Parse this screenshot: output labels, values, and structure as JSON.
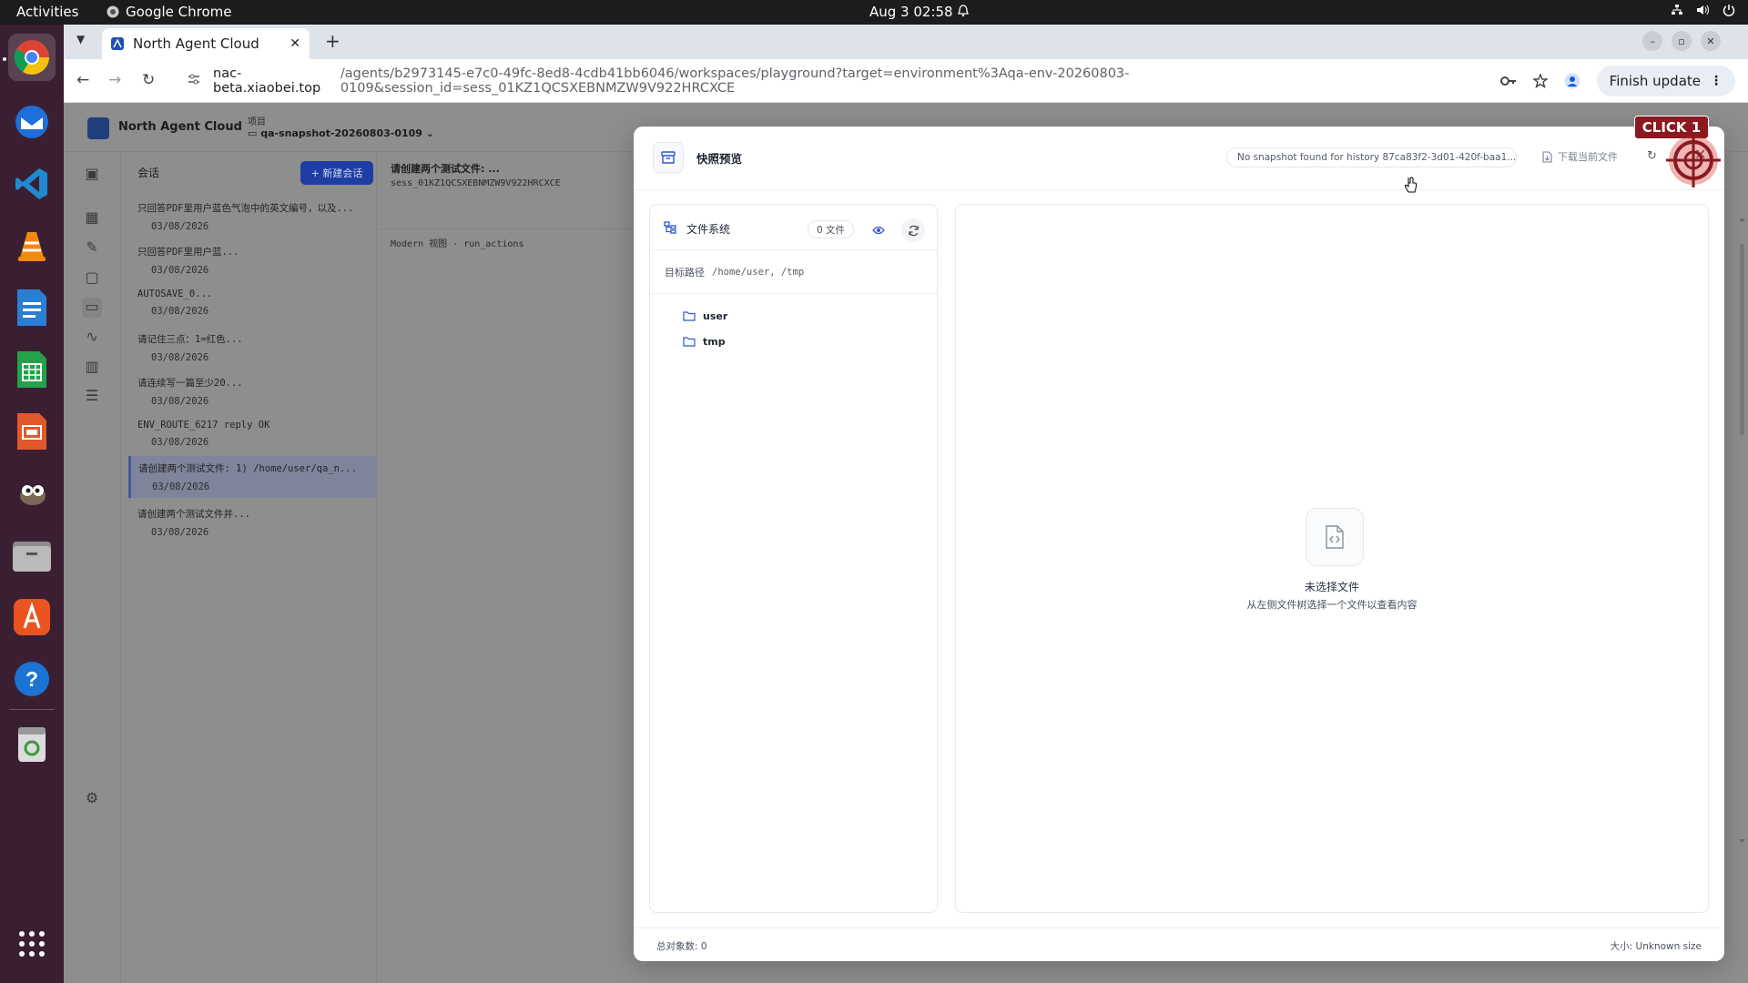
{
  "topbar": {
    "activities": "Activities",
    "app_name": "Google Chrome",
    "clock": "Aug 3  02:58"
  },
  "dock": {
    "apps": [
      "chrome-icon",
      "thunderbird-icon",
      "vscode-icon",
      "vlc-icon",
      "writer-icon",
      "calc-icon",
      "impress-icon",
      "gimp-icon",
      "files-icon",
      "appstore-icon",
      "help-icon",
      "trash-icon",
      "app-grid-icon"
    ]
  },
  "browser": {
    "tab_title": "North Agent Cloud",
    "url_host": "nac-beta.xiaobei.top",
    "url_path": "/agents/b2973145-e7c0-49fc-8ed8-4cdb41bb6046/workspaces/playground?target=environment%3Aqa-env-20260803-0109&session_id=sess_01KZ1QCSXEBNMZW9V922HRCXCE",
    "finish_update": "Finish update"
  },
  "app": {
    "brand": "North Agent Cloud",
    "project_label": "项目",
    "project_value": "qa-snapshot-20260803-0109",
    "sessions_title": "会话",
    "new_session": "+ 新建会话",
    "sessions": [
      {
        "title": "只回答PDF里用户蓝色气泡中的英文编号，以及...",
        "date": "03/08/2026"
      },
      {
        "title": "只回答PDF里用户蓝...",
        "date": "03/08/2026"
      },
      {
        "title": "AUTOSAVE_0...",
        "date": "03/08/2026"
      },
      {
        "title": "请记住三点：1=红色...",
        "date": "03/08/2026"
      },
      {
        "title": "请连续写一篇至少20...",
        "date": "03/08/2026"
      },
      {
        "title": "ENV_ROUTE_6217 reply OK",
        "date": "03/08/2026"
      },
      {
        "title": "请创建两个测试文件: 1) /home/user/qa_n...",
        "date": "03/08/2026"
      },
      {
        "title": "请创建两个测试文件并...",
        "date": "03/08/2026"
      }
    ],
    "main_title": "请创建两个测试文件: ...",
    "main_session_id": "sess_01KZ1QCSXEBNMZW9V922HRCXCE",
    "main_mode": "Modern 视图 · run_actions"
  },
  "modal": {
    "title": "快照预览",
    "snapshot_note": "No snapshot found for history 87ca83f2-3d01-420f-baa1...",
    "download_label": "下载当前文件",
    "fs_title": "文件系统",
    "fs_count": "0 文件",
    "target_label": "目标路径",
    "target_paths": "/home/user, /tmp",
    "tree": [
      "user",
      "tmp"
    ],
    "empty_title": "未选择文件",
    "empty_sub": "从左侧文件树选择一个文件以查看内容",
    "total_objects": "总对象数: 0",
    "size_label": "大小: Unknown size"
  },
  "overlay": {
    "click_label": "CLICK 1"
  }
}
